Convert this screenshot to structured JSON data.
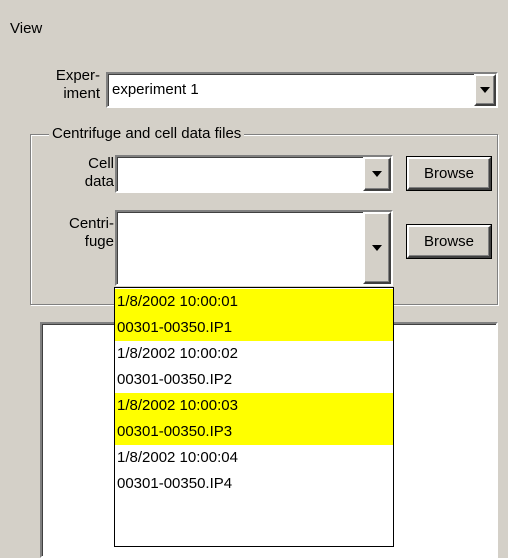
{
  "view_label": "View",
  "experiment": {
    "label_line1": "Exper-",
    "label_line2": "iment",
    "value": "experiment 1"
  },
  "groupbox": {
    "title": "Centrifuge and cell data files"
  },
  "cell_data": {
    "label_line1": "Cell",
    "label_line2": "data",
    "value": "",
    "browse_label": "Browse"
  },
  "centrifuge": {
    "label_line1": "Centri-",
    "label_line2": "fuge",
    "value": "",
    "browse_label": "Browse"
  },
  "dropdown_items": [
    {
      "text": "1/8/2002  10:00:01",
      "highlight": true
    },
    {
      "text": "00301-00350.IP1",
      "highlight": true
    },
    {
      "text": "1/8/2002  10:00:02",
      "highlight": false
    },
    {
      "text": "00301-00350.IP2",
      "highlight": false
    },
    {
      "text": "1/8/2002  10:00:03",
      "highlight": true
    },
    {
      "text": "00301-00350.IP3",
      "highlight": true
    },
    {
      "text": "1/8/2002  10:00:04",
      "highlight": false
    },
    {
      "text": "00301-00350.IP4",
      "highlight": false
    }
  ],
  "colors": {
    "highlight": "#ffff00",
    "face": "#d4d0c8"
  }
}
